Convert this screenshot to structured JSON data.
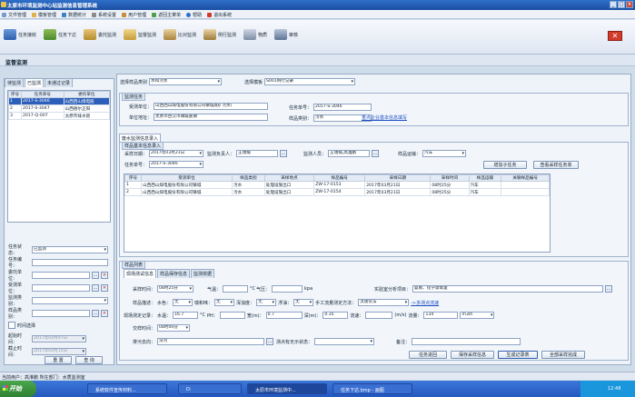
{
  "window": {
    "title": "太原市环境监测中心站监测信息管理系统"
  },
  "menu": [
    "文件管理",
    "模板管理",
    "数据统计",
    "系统设置",
    "用户管理",
    "返回主菜单",
    "帮助",
    "退出系统"
  ],
  "toolbar": [
    "任务接收",
    "任务下达",
    "委托监测",
    "监督监测",
    "比对监测",
    "例行监测",
    "物质",
    "审核"
  ],
  "module_title": "监督监测",
  "left": {
    "tabs": [
      "待监测",
      "已监测",
      "未通过记录"
    ],
    "columns": [
      "序号",
      "任务单号",
      "委托单位"
    ],
    "rows": [
      {
        "no": "1",
        "id": "2017-S-3046",
        "unit": "山西西山煤电股"
      },
      {
        "no": "2",
        "id": "2017-S-3047",
        "unit": "山西德尔正阳"
      },
      {
        "no": "3",
        "id": "2017-Q-007",
        "unit": "太原市排水管"
      }
    ],
    "fields": [
      {
        "label": "任务状态：",
        "value": "已监测"
      },
      {
        "label": "任务编号：",
        "value": ""
      },
      {
        "label": "委托单位：",
        "value": ""
      },
      {
        "label": "受测单位：",
        "value": ""
      },
      {
        "label": "监测类别：",
        "value": ""
      },
      {
        "label": "样品类别：",
        "value": ""
      }
    ],
    "time_check": "时间选择",
    "start_label": "起始时间：",
    "start_value": "2017年04月07日",
    "end_label": "截止时间：",
    "end_value": "2017年04月15日",
    "reset": "重 置",
    "query": "查 询"
  },
  "right": {
    "sample_type_label": "选择样品类别",
    "sample_type": "水和污水",
    "template_label": "选择模板",
    "template": "S001例行记录",
    "task_section": "监测任务",
    "entrust_label": "受测单位：",
    "entrust_value": "山西西山煤电股份有限公司镇城底矿污水厂",
    "address_label": "单位地址：",
    "address_value": "太原市古交市镇城底镇",
    "taskno_label": "任务单号：",
    "taskno_value": "2017-S-3046",
    "cat_label": "样品类别：",
    "cat_value": "污水",
    "link": "重点企业基本信息填写",
    "record_tab": "废水监测信息录入",
    "entry_caption": "样品基本信息录入",
    "date_label": "采样日期：",
    "date_value": "2017年03月21日",
    "leader_label": "监测负责人：",
    "leader_value": "王瑞楠",
    "people_label": "监测人员：",
    "people_value": "王瑞楠,高淮鹏",
    "transport_label": "样品运输：",
    "transport_value": "汽车",
    "task_id_label": "任务单号：",
    "task_id_value": "2017-S-3046",
    "add_btn": "增加子任务",
    "view_btn": "查看采样任务单",
    "cols": [
      "序号",
      "受测单位",
      "样品类别",
      "采样地点",
      "样品编号",
      "采样日期",
      "采样时间",
      "样品运输",
      "关联样品编号"
    ],
    "rows": [
      {
        "no": "1",
        "unit": "山西西山煤电股份有限公司镇城",
        "cat": "污水",
        "loc": "处理设施出口",
        "sid": "ZW-17-0153",
        "date": "2017年03月21日",
        "time": "08时25分",
        "trans": "汽车",
        "rel": ""
      },
      {
        "no": "2",
        "unit": "山西西山煤电股份有限公司镇城",
        "cat": "污水",
        "loc": "处理设施出口",
        "sid": "ZW-17-0154",
        "date": "2017年03月21日",
        "time": "08时25分",
        "trans": "汽车",
        "rel": ""
      }
    ],
    "sample_caption": "样品列表",
    "subtabs": [
      "现场测试信息",
      "样品保存信息",
      "监测依据"
    ],
    "time_label": "采样时间：",
    "time_value": "08时25分",
    "air_label": "气温：",
    "air_unit": "°C",
    "press_label": "气压：",
    "press_unit": "kpa",
    "lab_label": "实验室分析项目：",
    "lab_value": "氨氮、化学需氧量",
    "desc_label": "样品描述：",
    "color_label": "水色：",
    "color_value": "无",
    "smell_label": "嗅和味：",
    "smell_value": "无",
    "turb_label": "浑浊度：",
    "turb_value": "无",
    "float_label": "浮油：",
    "float_value": "无",
    "method_label": "手工流量测定方法：",
    "method_value": "流速仪法",
    "multi_label": "->多测点流速",
    "field_label": "现场测定记录：",
    "wt_label": "水温：",
    "wt_value": "16.7",
    "wt_unit": "°C",
    "ph_label": "PH：",
    "ph_value": "",
    "width_label": "宽(m)：",
    "width_value": "0.7",
    "depth_label": "深(m)：",
    "depth_value": "0.35",
    "speed_label": "流速：",
    "speed_unit": "(m/s)",
    "flow_label": "流量：",
    "flow_value": "134",
    "flow_unit": "m3/h",
    "ctime_label": "交样时间：",
    "ctime_value": "08时00分",
    "dest_label": "排污去向：",
    "dest_value": "汾河",
    "point_label": "测点有无示状态：",
    "remark_label": "备注：",
    "bot_tabs": [
      "任务进回",
      "保存采样信息",
      "生成记录表",
      "全部采样完成"
    ]
  },
  "status": "当前用户：高淮鹏  所在部门：水质监测室",
  "taskbar": {
    "start": "开始",
    "items": [
      "系统软件宣传材料...",
      "D:",
      "太原市环境监测中...",
      "任务下达.bmp - 画图"
    ],
    "clock": "12:48"
  }
}
